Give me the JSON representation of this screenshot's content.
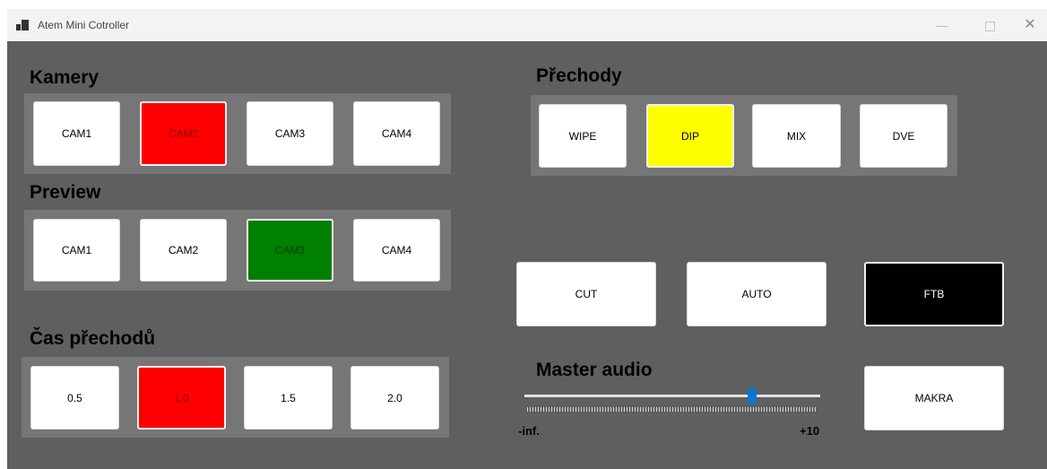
{
  "window": {
    "title": "Atem Mini Cotroller",
    "minimize_glyph": "—",
    "maximize_icon": "square-icon",
    "close_glyph": "✕"
  },
  "kamery": {
    "label": "Kamery",
    "buttons": [
      "CAM1",
      "CAM2",
      "CAM3",
      "CAM4"
    ],
    "active": "CAM2",
    "active_color": "#ff0000"
  },
  "preview": {
    "label": "Preview",
    "buttons": [
      "CAM1",
      "CAM2",
      "CAM3",
      "CAM4"
    ],
    "active": "CAM3",
    "active_color": "#008000"
  },
  "cas": {
    "label": "Čas přechodů",
    "buttons": [
      "0.5",
      "1.0",
      "1.5",
      "2.0"
    ],
    "active": "1.0",
    "active_color": "#ff0000"
  },
  "prechody": {
    "label": "Přechody",
    "buttons": [
      "WIPE",
      "DIP",
      "MIX",
      "DVE"
    ],
    "active": "DIP",
    "active_color": "#ffff00"
  },
  "actions": {
    "cut": "CUT",
    "auto": "AUTO",
    "ftb": "FTB",
    "ftb_color": "#000000"
  },
  "audio": {
    "label": "Master audio",
    "min_label": "-inf.",
    "max_label": "+10",
    "level_fraction": 0.77
  },
  "makra": "MAKRA",
  "colors": {
    "background": "#5f5f5f",
    "panel": "#767676"
  }
}
